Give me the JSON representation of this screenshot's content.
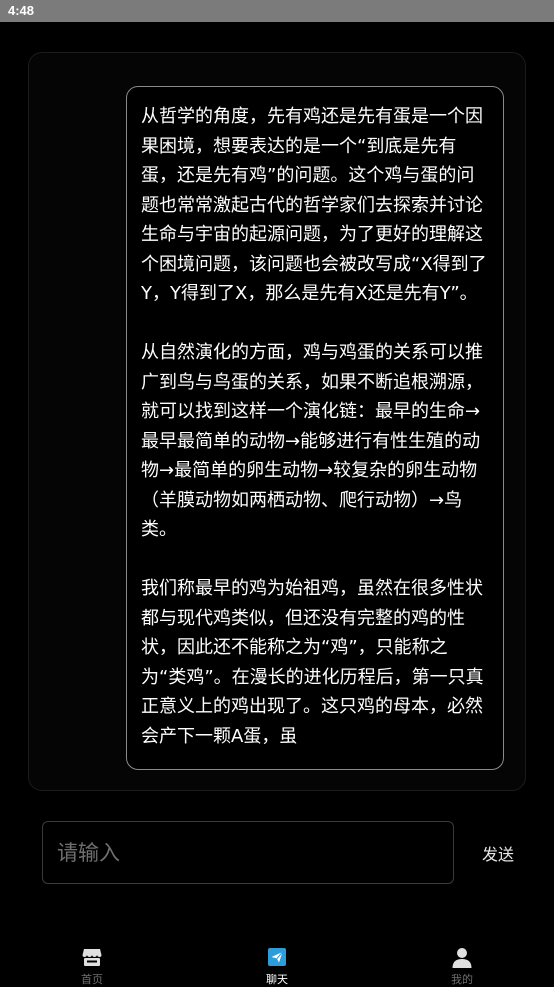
{
  "status_bar": {
    "time": "4:48"
  },
  "chat": {
    "paragraphs": [
      "从哲学的角度，先有鸡还是先有蛋是一个因果困境，想要表达的是一个“到底是先有蛋，还是先有鸡”的问题。这个鸡与蛋的问题也常常激起古代的哲学家们去探索并讨论生命与宇宙的起源问题，为了更好的理解这个困境问题，该问题也会被改写成“X得到了Y，Y得到了X，那么是先有X还是先有Y”。",
      "从自然演化的方面，鸡与鸡蛋的关系可以推广到鸟与鸟蛋的关系，如果不断追根溯源，就可以找到这样一个演化链：最早的生命→最早最简单的动物→能够进行有性生殖的动物→最简单的卵生动物→较复杂的卵生动物（羊膜动物如两栖动物、爬行动物）→鸟类。",
      "我们称最早的鸡为始祖鸡，虽然在很多性状都与现代鸡类似，但还没有完整的鸡的性状，因此还不能称之为“鸡”，只能称之为“类鸡”。在漫长的进化历程后，第一只真正意义上的鸡出现了。这只鸡的母本，必然会产下一颗A蛋，虽"
    ]
  },
  "composer": {
    "placeholder": "请输入",
    "value": "",
    "send_label": "发送"
  },
  "tabs": [
    {
      "label": "首页",
      "icon": "store-icon",
      "active": false
    },
    {
      "label": "聊天",
      "icon": "send-icon",
      "active": true
    },
    {
      "label": "我的",
      "icon": "user-icon",
      "active": false
    }
  ],
  "colors": {
    "background": "#000000",
    "active_tab_icon": "#2d9cdb",
    "inactive_tab": "#6e6e6e",
    "bubble_border": "#8a8a8a"
  }
}
